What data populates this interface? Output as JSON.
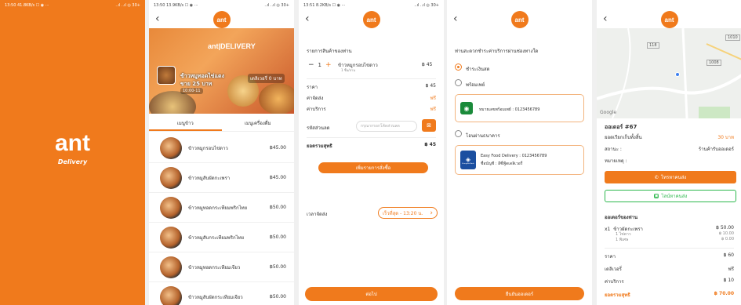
{
  "colors": {
    "accent": "#f07a1c",
    "green": "#2db84d"
  },
  "splash": {
    "status_left": "13:50 41.8KB/s ☐ ◉ ···",
    "status_right": "..ıl ..ıl ◎ 30+",
    "logo": "ant",
    "subtitle": "Delivery"
  },
  "menu_screen": {
    "status_left": "13:50 13.9KB/s ☐ ◉ ···",
    "status_right": "..ıl ..ıl ◎ 30+",
    "logo": "ant",
    "banner_title": "ant|DELIVERY",
    "banner_name": "ข้าวหมูทอดไข่แดง",
    "banner_price": "ขาย 25 บาท",
    "banner_time": "10:00-11",
    "banner_delivery": "เดลิเวอรี่ 0 บาท",
    "tabs": [
      "เมนูข้าว",
      "เมนูเครื่องดื่ม"
    ],
    "items": [
      {
        "name": "ข้าวหมูกรอบไข่ดาว",
        "price": "฿45.00"
      },
      {
        "name": "ข้าวหมูสับผัดกะเพรา",
        "price": "฿45.00"
      },
      {
        "name": "ข้าวหมูทอดกระเทียมพริกไทย",
        "price": "฿50.00"
      },
      {
        "name": "ข้าวหมูสับกระเทียมพริกไทย",
        "price": "฿50.00"
      },
      {
        "name": "ข้าวหมูทอดกระเทียมเจียว",
        "price": "฿50.00"
      },
      {
        "name": "ข้าวหมูสับผัดกระเทียมเจียว",
        "price": "฿50.00"
      }
    ]
  },
  "order_screen": {
    "status_left": "13:51 8.2KB/s ☐ ◉ ···",
    "status_right": "..ıl ..ıl ◎ 30+",
    "logo": "ant",
    "section_title": "รายการสินค้าของท่าน",
    "qty_minus": "−",
    "qty": "1",
    "qty_plus": "+",
    "item_name": "ข้าวหมูกรอบไข่ดาว",
    "item_note": "1 ชิ้น/จาน",
    "item_price": "฿ 45",
    "price_label": "ราคา",
    "price_value": "฿ 45",
    "delivery_label": "ค่าจัดส่ง",
    "delivery_value": "ฟรี",
    "service_label": "ค่าบริการ",
    "service_value": "ฟรี",
    "code_label": "รหัสส่วนลด",
    "code_placeholder": "กรุณากรอกโค้ดส่วนลด",
    "code_btn": "⊠",
    "total_label": "ยอดรวมสุทธิ",
    "total_value": "฿ 45",
    "add_btn": "เพิ่มรายการสั่งซื้อ",
    "time_label": "เวลาจัดส่ง",
    "time_value": "เร็วที่สุด - 13:20 น.",
    "time_chevron": "›",
    "next_btn": "ต่อไป"
  },
  "payment_screen": {
    "logo": "ant",
    "title": "ท่านสะดวกชำระค่าบริการผ่านช่องทางใด",
    "opt_cash": "ชำระเงินสด",
    "opt_promptpay": "พร้อมเพย์",
    "promptpay_text": "หมายเลขพร้อมเพย์ : 0123456789",
    "opt_bank": "โอนผ่านธนาคาร",
    "bank_line1": "Easy Food Delivery : 0123456789",
    "bank_line2": "ชื่อบัญชี : อีซี่ฟู้ดเดลิเวอรี่",
    "bank_logo_text": "Krungthai Bank",
    "confirm_btn": "ยืนยันออเดอร์"
  },
  "tracking_screen": {
    "logo": "ant",
    "google": "Google",
    "map_label1": "118",
    "map_label2": "1008",
    "map_label3": "1010",
    "order_title": "ออเดอร์ #67",
    "fee_label": "ยอดเรียกเก็บทั้งสิ้น",
    "fee_value": "30 บาท",
    "status_label": "สถานะ :",
    "status_value": "ร้านค้ารับออเดอร์",
    "note_label": "หมายเหตุ :",
    "call_btn": "โทรหาคนส่ง",
    "line_btn": "ไลน์หาคนส่ง",
    "list_title": "ออเดอร์ของท่าน",
    "order_qty": "x1",
    "order_item": "ข้าวผัดกะเพรา",
    "order_item_price": "฿ 50.00",
    "order_sub1": "1 ไข่ดาว",
    "order_sub1_price": "฿ 10.00",
    "order_sub2": "1 พิเศษ",
    "order_sub2_price": "฿ 0.00",
    "price_label": "ราคา",
    "price_value": "฿ 60",
    "delivery_label": "เดลิเวอรี่",
    "delivery_value": "ฟรี",
    "service_label": "ค่าบริการ",
    "service_value": "฿ 10",
    "total_label": "ยอดรวมสุทธิ",
    "total_value": "฿ 70.00"
  }
}
